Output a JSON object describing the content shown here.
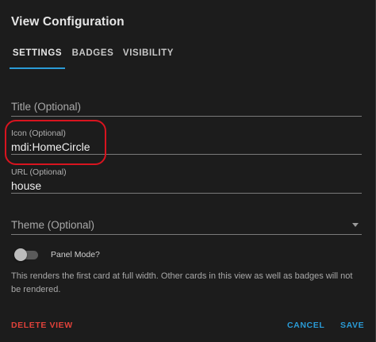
{
  "dialog": {
    "title": "View Configuration"
  },
  "tabs": [
    {
      "label": "SETTINGS",
      "active": true
    },
    {
      "label": "BADGES",
      "active": false
    },
    {
      "label": "VISIBILITY",
      "active": false
    }
  ],
  "fields": {
    "title": {
      "label": "Title (Optional)",
      "value": ""
    },
    "icon": {
      "label": "Icon (Optional)",
      "value": "mdi:HomeCircle"
    },
    "url": {
      "label": "URL (Optional)",
      "value": "house"
    },
    "theme": {
      "label": "Theme (Optional)",
      "value": ""
    }
  },
  "panel_mode": {
    "label": "Panel Mode?",
    "enabled": false,
    "description": "This renders the first card at full width. Other cards in this view as well as badges will not be rendered."
  },
  "actions": {
    "delete_label": "DELETE VIEW",
    "cancel_label": "CANCEL",
    "save_label": "SAVE"
  },
  "colors": {
    "accent": "#2a9bd6",
    "danger": "#e0423a",
    "annotation": "#d8141f",
    "background": "#1c1c1c"
  }
}
